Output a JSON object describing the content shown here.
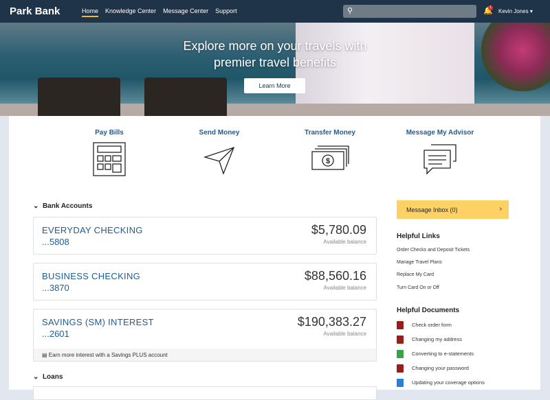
{
  "nav": {
    "brand": "Park Bank",
    "links": [
      "Home",
      "Knowledge Center",
      "Message Center",
      "Support"
    ],
    "search_placeholder": "",
    "notifications": "1",
    "user": "Kevin Jones"
  },
  "hero": {
    "line1": "Explore more on your travels with",
    "line2": "premier travel benefits",
    "button": "Learn More"
  },
  "quick_actions": [
    {
      "label": "Pay Bills",
      "icon": "calculator-icon"
    },
    {
      "label": "Send Money",
      "icon": "paper-plane-icon"
    },
    {
      "label": "Transfer Money",
      "icon": "cash-icon"
    },
    {
      "label": "Message My Advisor",
      "icon": "chat-icon"
    }
  ],
  "bank_accounts": {
    "title": "Bank Accounts",
    "accounts": [
      {
        "name": "EVERYDAY CHECKING",
        "number": "...5808",
        "balance": "$5,780.09",
        "label": "Available balance"
      },
      {
        "name": "BUSINESS CHECKING",
        "number": "...3870",
        "balance": "$88,560.16",
        "label": "Available balance"
      },
      {
        "name": "SAVINGS (SM) INTEREST",
        "number": "...2601",
        "balance": "$190,383.27",
        "label": "Available balance",
        "promo": "Earn more interest with a Savings PLUS account"
      }
    ]
  },
  "loans": {
    "title": "Loans"
  },
  "sidebar": {
    "inbox": "Message Inbox (0)",
    "links_title": "Helpful Links",
    "links": [
      "Order Checks and Deposit Tickets",
      "Manage Travel Plans",
      "Replace My Card",
      "Turn Card On or Off"
    ],
    "docs_title": "Helpful Documents",
    "docs": [
      {
        "label": "Check order form",
        "color": "#9b1c1c"
      },
      {
        "label": "Changing my address",
        "color": "#9b1c1c"
      },
      {
        "label": "Converting to e-statements",
        "color": "#3aa34a"
      },
      {
        "label": "Changing your password",
        "color": "#9b1c1c"
      },
      {
        "label": "Updating your coverage options",
        "color": "#2b7fd6"
      }
    ]
  }
}
